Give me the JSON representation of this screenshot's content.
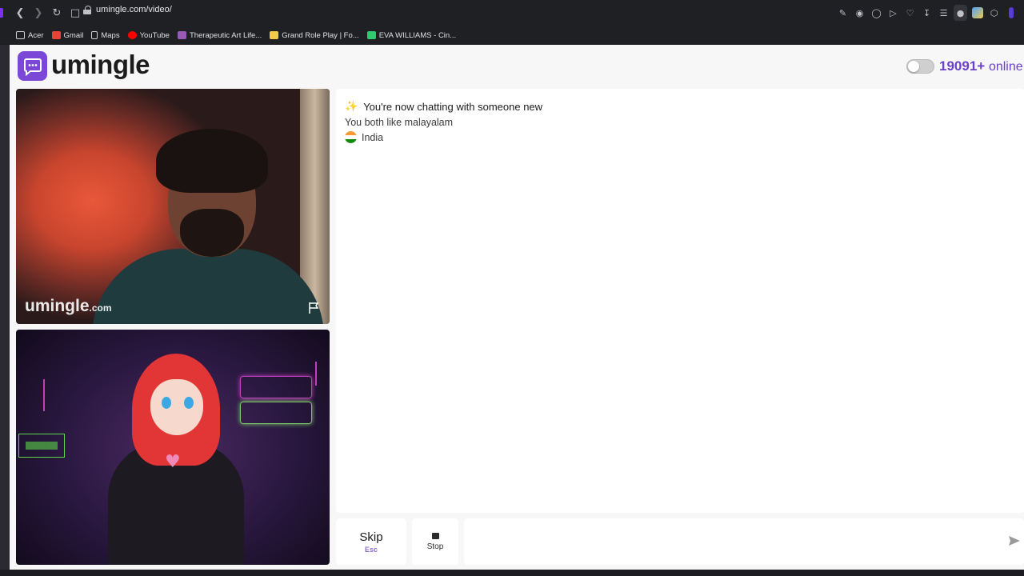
{
  "browser": {
    "url": "umingle.com/video/",
    "bookmarks": [
      {
        "label": "Acer",
        "color": "#cfcfcf"
      },
      {
        "label": "Gmail",
        "color": "#ea4335"
      },
      {
        "label": "Maps",
        "color": "#cfcfcf"
      },
      {
        "label": "YouTube",
        "color": "#ff0000"
      },
      {
        "label": "Therapeutic Art Life...",
        "color": "#9b59b6"
      },
      {
        "label": "Grand Role Play | Fo...",
        "color": "#f2c94c"
      },
      {
        "label": "EVA WILLIAMS - Cin...",
        "color": "#2ecc71"
      }
    ]
  },
  "site": {
    "logo": "umingle",
    "online_count": "19091+",
    "online_label": "online",
    "accent": "#7a47d6"
  },
  "video": {
    "watermark": "umingle",
    "watermark_suffix": ".com"
  },
  "chat": {
    "status": "You're now chatting with someone new",
    "common": "You both like malayalam",
    "country": "India"
  },
  "controls": {
    "skip_label": "Skip",
    "skip_key": "Esc",
    "stop_label": "Stop",
    "message_placeholder": ""
  }
}
